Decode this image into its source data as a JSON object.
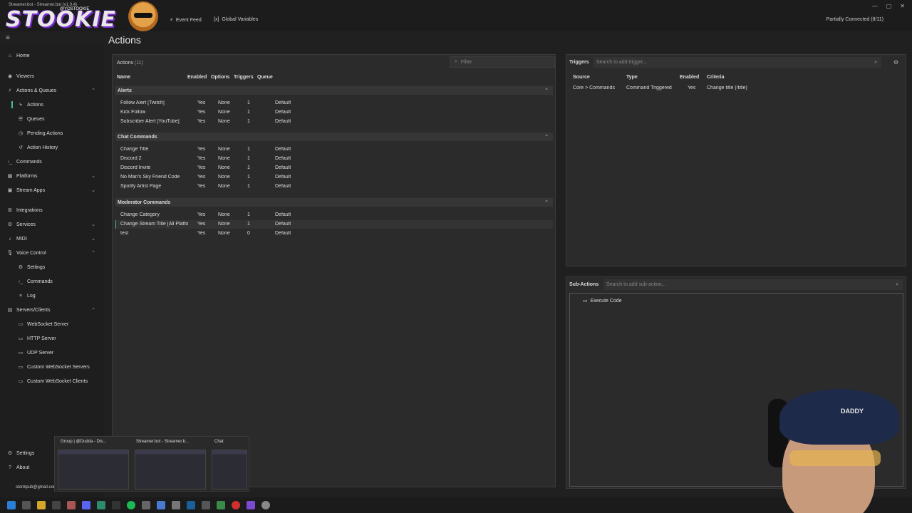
{
  "window": {
    "title": "Streamer.bot - Streamer.bot (v1.0.4)",
    "logo_text": "STOOKIE",
    "social_handle": "@YOSTOOKIE",
    "connection_status": "Partially Connected (8/11)"
  },
  "toplinks": [
    {
      "label": "Event Feed",
      "icon": "bolt-icon"
    },
    {
      "label": "Global Variables",
      "icon": "variable-icon"
    }
  ],
  "sidebar": {
    "items": [
      {
        "label": "Home",
        "icon": "home-icon"
      },
      {
        "label": "Viewers",
        "icon": "users-icon"
      },
      {
        "label": "Actions & Queues",
        "icon": "bolt-icon"
      },
      {
        "label": "Actions",
        "icon": "bolt-icon"
      },
      {
        "label": "Queues",
        "icon": "queue-icon"
      },
      {
        "label": "Pending Actions",
        "icon": "clock-icon"
      },
      {
        "label": "Action History",
        "icon": "history-icon"
      },
      {
        "label": "Commands",
        "icon": "terminal-icon"
      },
      {
        "label": "Platforms",
        "icon": "grid-icon"
      },
      {
        "label": "Stream Apps",
        "icon": "app-icon"
      },
      {
        "label": "Integrations",
        "icon": "plug-icon"
      },
      {
        "label": "Services",
        "icon": "service-icon"
      },
      {
        "label": "MIDI",
        "icon": "midi-icon"
      },
      {
        "label": "Voice Control",
        "icon": "mic-icon"
      },
      {
        "label": "Settings",
        "icon": "gear-icon"
      },
      {
        "label": "Commands",
        "icon": "terminal-icon"
      },
      {
        "label": "Log",
        "icon": "log-icon"
      },
      {
        "label": "Servers/Clients",
        "icon": "server-icon"
      },
      {
        "label": "WebSocket Server",
        "icon": "socket-icon"
      },
      {
        "label": "HTTP Server",
        "icon": "server-icon"
      },
      {
        "label": "UDP Server",
        "icon": "server-icon"
      },
      {
        "label": "Custom WebSocket Servers",
        "icon": "socket-icon"
      },
      {
        "label": "Custom WebSocket Clients",
        "icon": "socket-icon"
      },
      {
        "label": "Settings",
        "icon": "gear-icon"
      },
      {
        "label": "About",
        "icon": "info-icon"
      }
    ],
    "email": "stonkpub@gmail.com"
  },
  "main": {
    "title": "Actions",
    "panel_label": "Actions",
    "panel_count": "(11)",
    "filter_placeholder": "Filter",
    "columns": [
      "Name",
      "Enabled",
      "Options",
      "Triggers",
      "Queue"
    ],
    "groups": [
      {
        "name": "Alerts",
        "rows": [
          [
            "Follow Alert [Twitch]",
            "Yes",
            "None",
            "1",
            "Default"
          ],
          [
            "Kick Follow",
            "Yes",
            "None",
            "1",
            "Default"
          ],
          [
            "Subscriber Alert [YouTube]",
            "Yes",
            "None",
            "1",
            "Default"
          ]
        ]
      },
      {
        "name": "Chat Commands",
        "rows": [
          [
            "Change Title",
            "Yes",
            "None",
            "1",
            "Default"
          ],
          [
            "Discord 2",
            "Yes",
            "None",
            "1",
            "Default"
          ],
          [
            "Discord Invite",
            "Yes",
            "None",
            "1",
            "Default"
          ],
          [
            "No Man's Sky Friend Code",
            "Yes",
            "None",
            "1",
            "Default"
          ],
          [
            "Spotify Artist Page",
            "Yes",
            "None",
            "1",
            "Default"
          ]
        ]
      },
      {
        "name": "Moderator Commands",
        "rows": [
          [
            "Change Category",
            "Yes",
            "None",
            "1",
            "Default"
          ],
          [
            "Change Stream Title [All Platfo",
            "Yes",
            "None",
            "1",
            "Default"
          ],
          [
            "test",
            "Yes",
            "None",
            "0",
            "Default"
          ]
        ]
      }
    ]
  },
  "triggers": {
    "title": "Triggers",
    "search_placeholder": "Search to add trigger...",
    "columns": [
      "Source",
      "Type",
      "Enabled",
      "Criteria"
    ],
    "rows": [
      [
        "Core > Commands",
        "Command Triggered",
        "Yes",
        "Change title (!title)"
      ]
    ]
  },
  "subactions": {
    "title": "Sub-Actions",
    "search_placeholder": "Search to add sub-action...",
    "items": [
      "Execute Code"
    ]
  },
  "taskbar_thumbs": [
    "Group | @Dudda - Dis...",
    "Streamer.bot - Streamer.b...",
    "Chat"
  ],
  "webcam": {
    "cap_text": "DADDY"
  },
  "colors": {
    "accent": "#46c28a",
    "background": "#202020",
    "panel": "#2b2b2b"
  }
}
